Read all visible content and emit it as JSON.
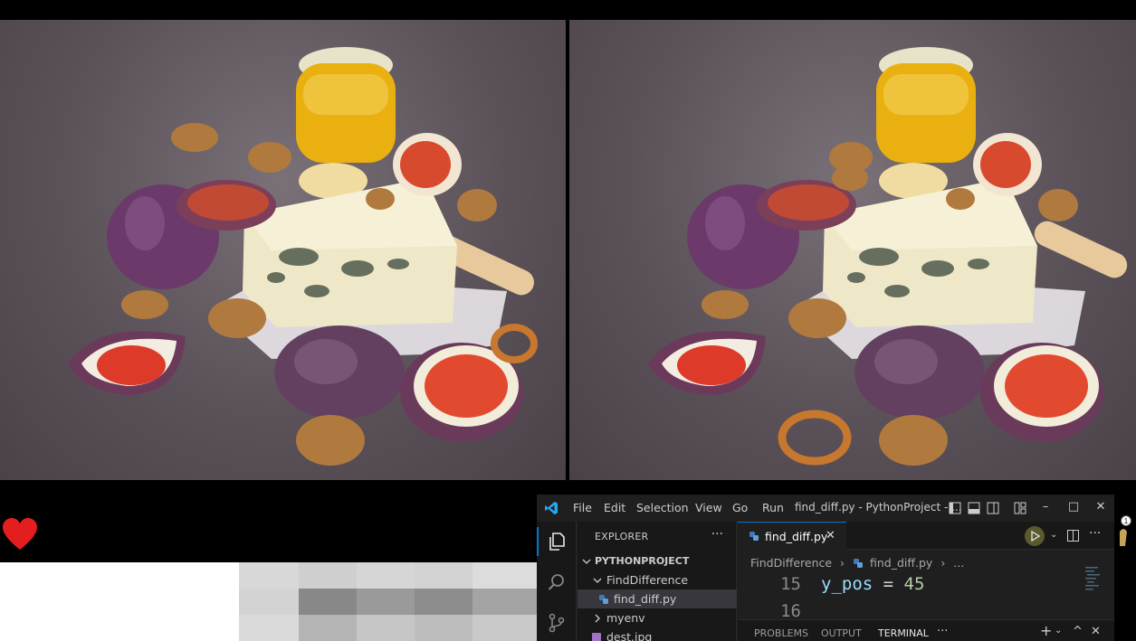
{
  "game": {
    "left_panel": "original-image",
    "right_panel": "modified-image"
  },
  "vscode": {
    "menu": [
      "File",
      "Edit",
      "Selection",
      "View",
      "Go",
      "Run"
    ],
    "window_title": "find_diff.py - PythonProject - ...",
    "explorer_title": "EXPLORER",
    "explorer_more": "···",
    "project_name": "PYTHONPROJECT",
    "tree": [
      {
        "label": "FindDifference"
      },
      {
        "label": "find_diff.py"
      },
      {
        "label": "myenv"
      },
      {
        "label": "dest.jpg"
      }
    ],
    "tab_label": "find_diff.py",
    "breadcrumb": {
      "folder": "FindDifference",
      "file": "find_diff.py",
      "rest": "..."
    },
    "lines": [
      {
        "number": "15",
        "var": "y_pos",
        "op": " = ",
        "num": "45"
      },
      {
        "number": "16",
        "var": "",
        "op": "",
        "num": ""
      }
    ],
    "panel_tabs": [
      "PROBLEMS",
      "OUTPUT",
      "TERMINAL"
    ],
    "panel_more": "···",
    "notification_badge": "1",
    "colors": {
      "accent": "#0078d4",
      "background": "#1f1f1f",
      "sidebar": "#181818"
    }
  }
}
